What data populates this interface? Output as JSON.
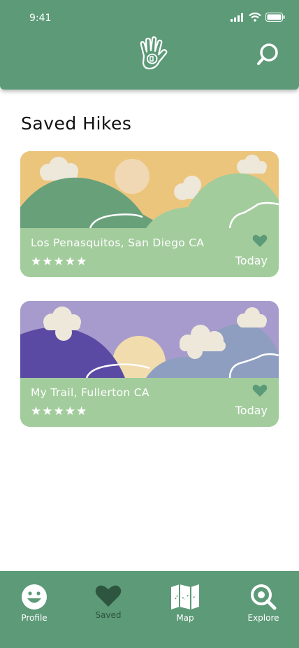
{
  "status": {
    "time": "9:41"
  },
  "page": {
    "title": "Saved Hikes"
  },
  "hikes": [
    {
      "name": "Los Penasquitos, San Diego CA",
      "stars": "★★★★★",
      "date": "Today"
    },
    {
      "name": "My Trail, Fullerton CA",
      "stars": "★★★★★",
      "date": "Today"
    }
  ],
  "tabs": [
    {
      "label": "Profile"
    },
    {
      "label": "Saved"
    },
    {
      "label": "Map"
    },
    {
      "label": "Explore"
    }
  ],
  "colors": {
    "brand": "#5c9a78",
    "card": "#a3cc9d",
    "active_tab": "#2e5540"
  }
}
